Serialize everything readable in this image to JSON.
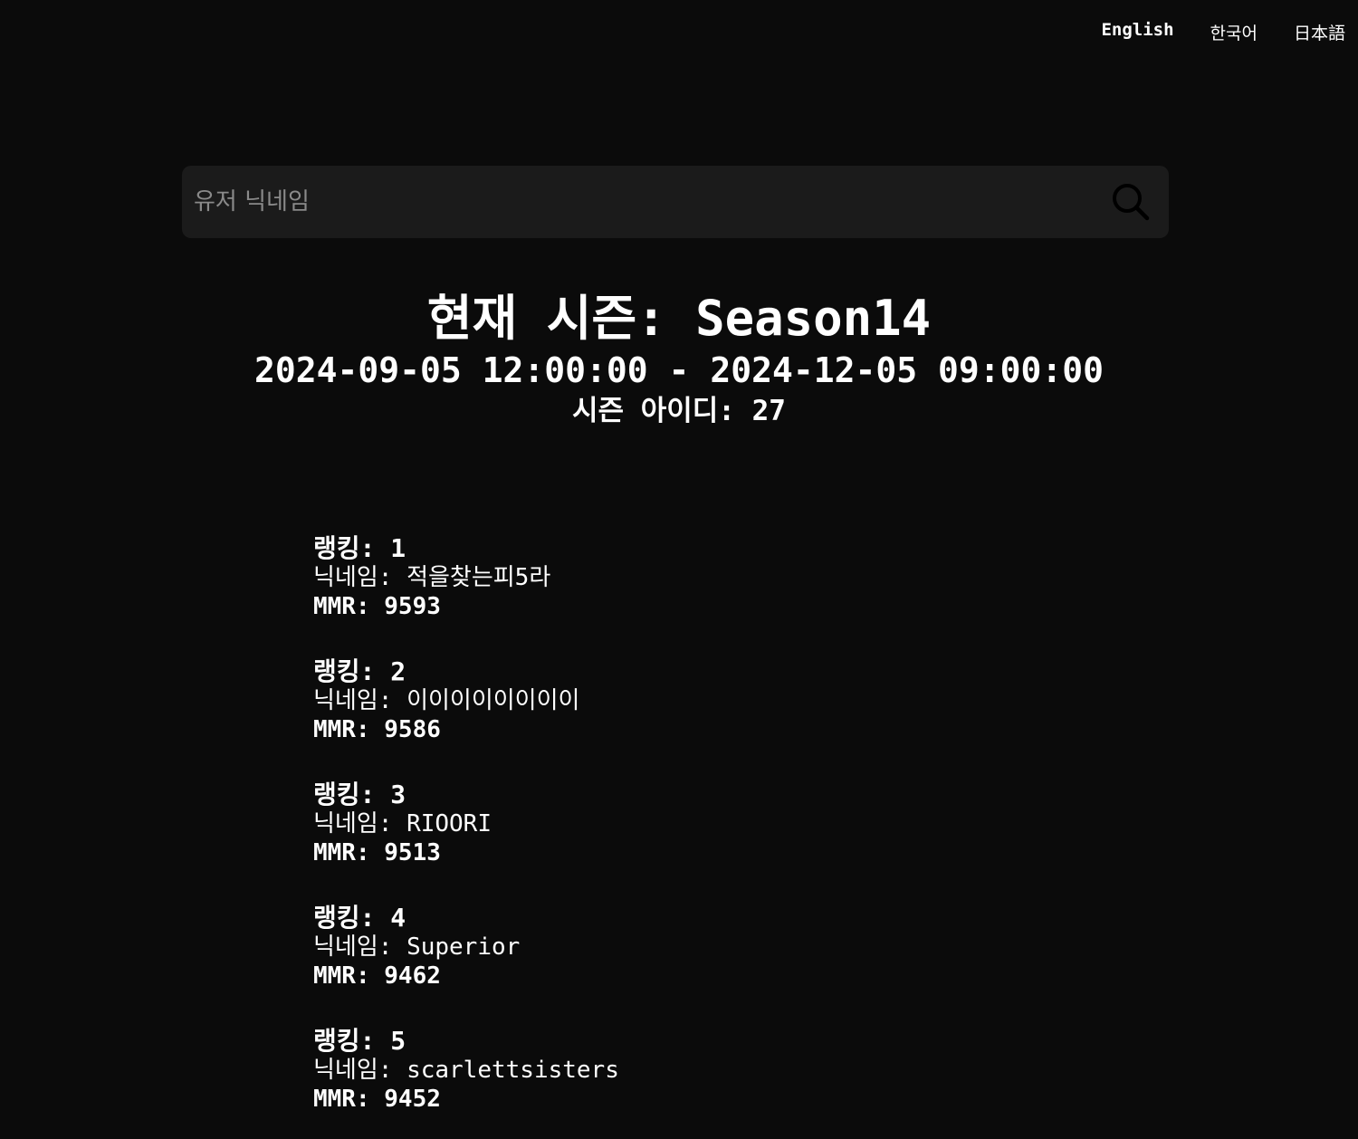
{
  "languages": [
    {
      "label": "English",
      "active": true
    },
    {
      "label": "한국어",
      "active": false
    },
    {
      "label": "日本語",
      "active": false
    }
  ],
  "search": {
    "placeholder": "유저 닉네임",
    "value": "",
    "icon": "search-icon"
  },
  "season": {
    "title": "현재 시즌: Season14",
    "range": "2024-09-05 12:00:00 - 2024-12-05 09:00:00",
    "id_text": "시즌 아이디: 27"
  },
  "rankings": [
    {
      "rank_label": "랭킹: 1",
      "nickname_label": "닉네임: 적을찾는피5라",
      "mmr_label": "MMR: 9593"
    },
    {
      "rank_label": "랭킹: 2",
      "nickname_label": "닉네임: 이이이이이이이이",
      "mmr_label": "MMR: 9586"
    },
    {
      "rank_label": "랭킹: 3",
      "nickname_label": "닉네임: RIOORI",
      "mmr_label": "MMR: 9513"
    },
    {
      "rank_label": "랭킹: 4",
      "nickname_label": "닉네임: Superior",
      "mmr_label": "MMR: 9462"
    },
    {
      "rank_label": "랭킹: 5",
      "nickname_label": "닉네임: scarlettsisters",
      "mmr_label": "MMR: 9452"
    }
  ],
  "colors": {
    "background": "#0b0b0b",
    "search_bg": "#1b1b1b",
    "text": "#ffffff",
    "placeholder": "#8a8a8a"
  }
}
